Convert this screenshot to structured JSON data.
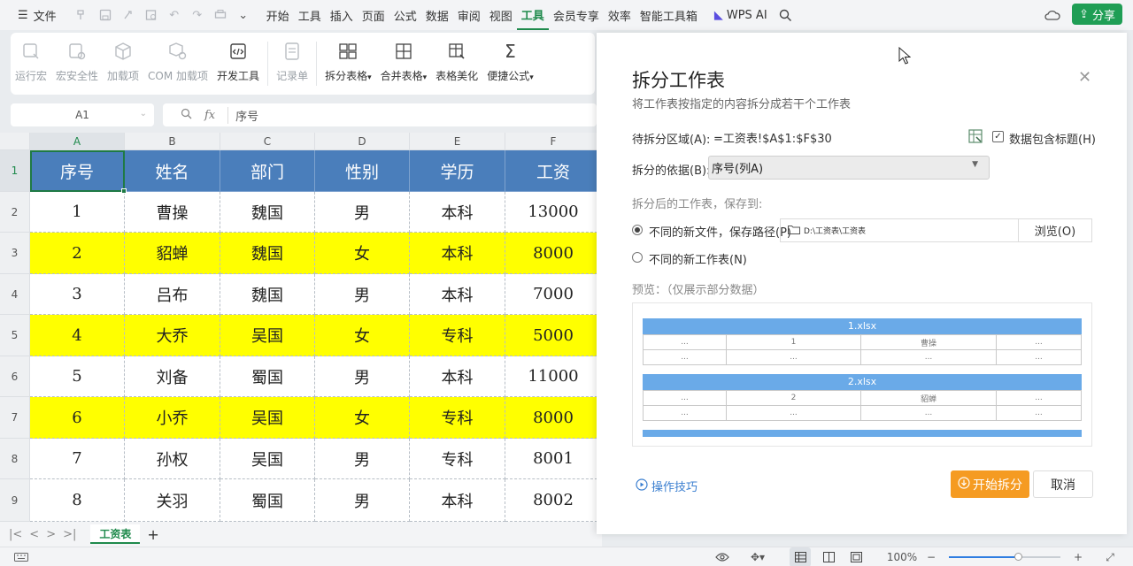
{
  "menubar": {
    "file_label": "文件",
    "tabs": [
      {
        "label": "开始"
      },
      {
        "label": "工具"
      },
      {
        "label": "插入"
      },
      {
        "label": "页面"
      },
      {
        "label": "公式"
      },
      {
        "label": "数据"
      },
      {
        "label": "审阅"
      },
      {
        "label": "视图"
      },
      {
        "label": "工具",
        "active": true
      },
      {
        "label": "会员专享"
      },
      {
        "label": "效率"
      },
      {
        "label": "智能工具箱"
      }
    ],
    "wps_ai": "WPS AI",
    "share": "分享"
  },
  "ribbon": {
    "items": [
      {
        "label": "运行宏",
        "icon": "run-macro-icon",
        "disabled": true
      },
      {
        "label": "宏安全性",
        "icon": "macro-security-icon",
        "disabled": true
      },
      {
        "label": "加载项",
        "icon": "addin-icon",
        "disabled": true
      },
      {
        "label": "COM 加载项",
        "icon": "com-addin-icon",
        "disabled": true
      },
      {
        "label": "开发工具",
        "icon": "developer-tools-icon",
        "disabled": false
      },
      {
        "label": "记录单",
        "icon": "record-form-icon",
        "disabled": true
      },
      {
        "label": "拆分表格",
        "icon": "split-table-icon",
        "disabled": false,
        "dropdown": true
      },
      {
        "label": "合并表格",
        "icon": "merge-table-icon",
        "disabled": false,
        "dropdown": true
      },
      {
        "label": "表格美化",
        "icon": "table-beautify-icon",
        "disabled": false
      },
      {
        "label": "便捷公式",
        "icon": "quick-formula-icon",
        "disabled": false,
        "dropdown": true
      }
    ]
  },
  "formula_bar": {
    "name_box": "A1",
    "fx": "fx",
    "value": "序号"
  },
  "grid": {
    "columns": [
      "A",
      "B",
      "C",
      "D",
      "E",
      "F"
    ],
    "rows": [
      "1",
      "2",
      "3",
      "4",
      "5",
      "6",
      "7",
      "8",
      "9"
    ],
    "header": [
      "序号",
      "姓名",
      "部门",
      "性别",
      "学历",
      "工资"
    ],
    "data": [
      {
        "cells": [
          "1",
          "曹操",
          "魏国",
          "男",
          "本科",
          "13000"
        ],
        "highlight": false
      },
      {
        "cells": [
          "2",
          "貂蝉",
          "魏国",
          "女",
          "本科",
          "8000"
        ],
        "highlight": true
      },
      {
        "cells": [
          "3",
          "吕布",
          "魏国",
          "男",
          "本科",
          "7000"
        ],
        "highlight": false
      },
      {
        "cells": [
          "4",
          "大乔",
          "吴国",
          "女",
          "专科",
          "5000"
        ],
        "highlight": true
      },
      {
        "cells": [
          "5",
          "刘备",
          "蜀国",
          "男",
          "本科",
          "11000"
        ],
        "highlight": false
      },
      {
        "cells": [
          "6",
          "小乔",
          "吴国",
          "女",
          "专科",
          "8000"
        ],
        "highlight": true
      },
      {
        "cells": [
          "7",
          "孙权",
          "吴国",
          "男",
          "专科",
          "8001"
        ],
        "highlight": false
      },
      {
        "cells": [
          "8",
          "关羽",
          "蜀国",
          "男",
          "本科",
          "8002"
        ],
        "highlight": false
      }
    ],
    "colors": {
      "header_bg": "#4a7ebb",
      "highlight_bg": "#ffff00"
    }
  },
  "sheet_tabs": {
    "active": "工资表",
    "add": "+"
  },
  "status_bar": {
    "zoom": "100%",
    "zoom_level": 0.62
  },
  "dialog": {
    "title": "拆分工作表",
    "subtitle": "将工作表按指定的内容拆分成若干个工作表",
    "range_label": "待拆分区域(A):",
    "range_value": "=工资表!$A$1:$F$30",
    "include_header_label": "数据包含标题(H)",
    "include_header_checked": true,
    "basis_label": "拆分的依据(B):",
    "basis_value": "序号(列A)",
    "save_to_label": "拆分后的工作表，保存到:",
    "option_new_file": "不同的新文件，保存路径(P)",
    "option_new_file_selected": true,
    "save_path": "D:\\工资表\\工资表",
    "browse": "浏览(O)",
    "option_new_sheet": "不同的新工作表(N)",
    "preview_label": "预览：（仅展示部分数据）",
    "preview": [
      {
        "title": "1.xlsx",
        "rows": [
          [
            "...",
            "1",
            "曹操",
            "..."
          ],
          [
            "...",
            "...",
            "...",
            "..."
          ]
        ]
      },
      {
        "title": "2.xlsx",
        "rows": [
          [
            "...",
            "2",
            "貂蝉",
            "..."
          ],
          [
            "...",
            "...",
            "...",
            "..."
          ]
        ]
      }
    ],
    "tips": "操作技巧",
    "start": "开始拆分",
    "cancel": "取消",
    "accent": "#f59b22"
  }
}
